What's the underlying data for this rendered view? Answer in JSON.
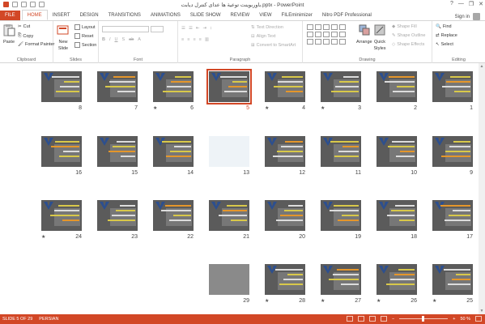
{
  "window": {
    "title": "باوربوينت توعية ها عداى كنترل ديابت.pptx - PowerPoint",
    "help": "?",
    "minimize": "—",
    "restore": "❐",
    "close": "✕"
  },
  "tabs": [
    {
      "label": "FILE"
    },
    {
      "label": "HOME"
    },
    {
      "label": "INSERT"
    },
    {
      "label": "DESIGN"
    },
    {
      "label": "TRANSITIONS"
    },
    {
      "label": "ANIMATIONS"
    },
    {
      "label": "SLIDE SHOW"
    },
    {
      "label": "REVIEW"
    },
    {
      "label": "VIEW"
    },
    {
      "label": "FILEminimizer"
    },
    {
      "label": "Nitro PDF Professional"
    }
  ],
  "account": {
    "signin": "Sign in"
  },
  "ribbon": {
    "clipboard": {
      "paste": "Paste",
      "cut": "Cut",
      "copy": "Copy",
      "format_painter": "Format Painter",
      "label": "Clipboard"
    },
    "slides": {
      "new_slide": "New",
      "new_slide2": "Slide",
      "layout": "Layout",
      "reset": "Reset",
      "section": "Section",
      "label": "Slides"
    },
    "font": {
      "label": "Font",
      "font_name": "",
      "font_size": ""
    },
    "paragraph": {
      "text_direction": "Text Direction",
      "align_text": "Align Text",
      "convert_smartart": "Convert to SmartArt",
      "label": "Paragraph"
    },
    "drawing": {
      "arrange": "Arrange",
      "quick_styles": "Quick",
      "quick_styles2": "Styles",
      "shape_fill": "Shape Fill",
      "shape_outline": "Shape Outline",
      "shape_effects": "Shape Effects",
      "label": "Drawing"
    },
    "editing": {
      "find": "Find",
      "replace": "Replace",
      "select": "Select",
      "label": "Editing"
    }
  },
  "slides": [
    {
      "num": "1",
      "star": false,
      "selected": false
    },
    {
      "num": "2",
      "star": false,
      "selected": false
    },
    {
      "num": "3",
      "star": true,
      "selected": false
    },
    {
      "num": "4",
      "star": true,
      "selected": false
    },
    {
      "num": "5",
      "star": false,
      "selected": true
    },
    {
      "num": "6",
      "star": true,
      "selected": false
    },
    {
      "num": "7",
      "star": false,
      "selected": false
    },
    {
      "num": "8",
      "star": false,
      "selected": false
    },
    {
      "num": "9",
      "star": false,
      "selected": false
    },
    {
      "num": "10",
      "star": false,
      "selected": false
    },
    {
      "num": "11",
      "star": false,
      "selected": false
    },
    {
      "num": "12",
      "star": false,
      "selected": false
    },
    {
      "num": "13",
      "star": false,
      "selected": false
    },
    {
      "num": "14",
      "star": false,
      "selected": false
    },
    {
      "num": "15",
      "star": false,
      "selected": false
    },
    {
      "num": "16",
      "star": false,
      "selected": false
    },
    {
      "num": "17",
      "star": false,
      "selected": false
    },
    {
      "num": "18",
      "star": false,
      "selected": false
    },
    {
      "num": "19",
      "star": false,
      "selected": false
    },
    {
      "num": "20",
      "star": false,
      "selected": false
    },
    {
      "num": "21",
      "star": false,
      "selected": false
    },
    {
      "num": "22",
      "star": false,
      "selected": false
    },
    {
      "num": "23",
      "star": false,
      "selected": false
    },
    {
      "num": "24",
      "star": true,
      "selected": false
    },
    {
      "num": "25",
      "star": true,
      "selected": false
    },
    {
      "num": "26",
      "star": true,
      "selected": false
    },
    {
      "num": "27",
      "star": true,
      "selected": false
    },
    {
      "num": "28",
      "star": true,
      "selected": false
    },
    {
      "num": "29",
      "star": false,
      "selected": false
    }
  ],
  "status": {
    "slide_count": "SLIDE 5 OF 29",
    "language": "PERSIAN",
    "zoom": "50 %"
  },
  "colors": {
    "accent": "#d24726",
    "thumb_bg": "#5b5b5b"
  }
}
